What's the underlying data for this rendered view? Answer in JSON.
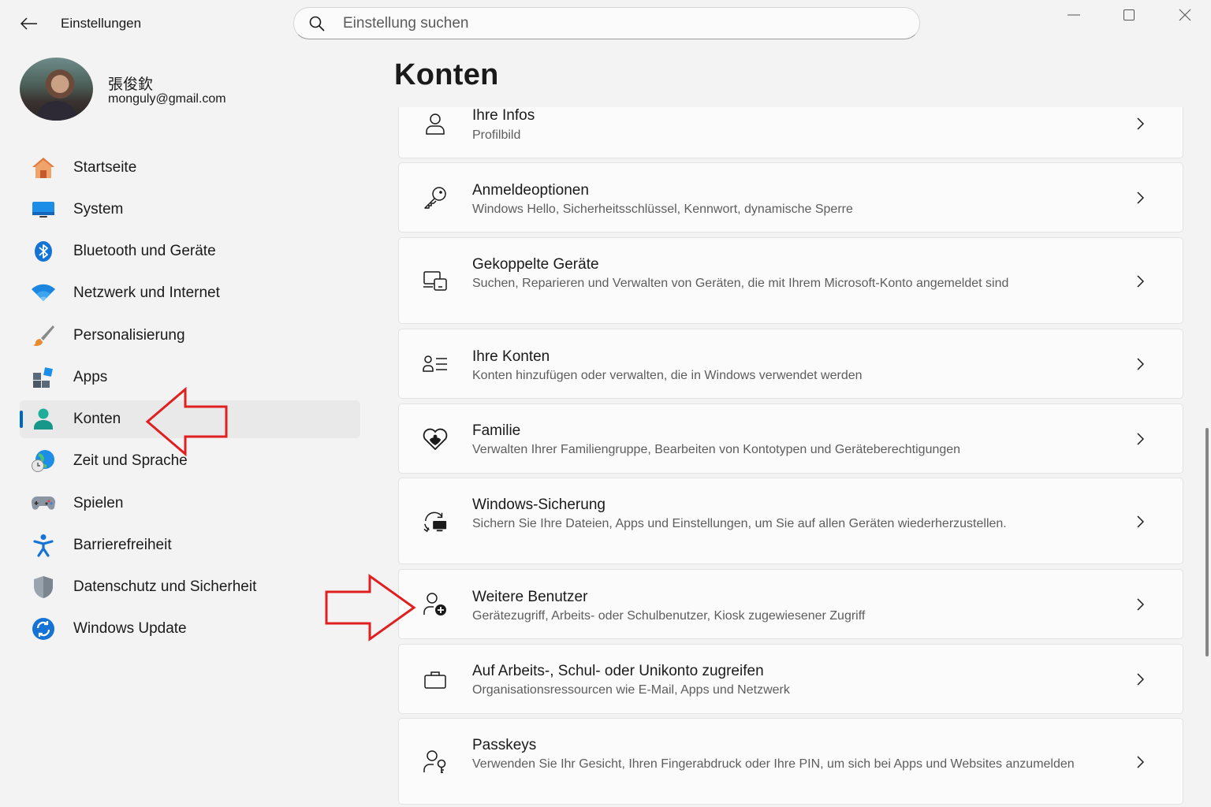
{
  "app": {
    "title": "Einstellungen"
  },
  "search": {
    "placeholder": "Einstellung suchen"
  },
  "user": {
    "name": "張俊欽",
    "email": "monguly@gmail.com"
  },
  "page_title": "Konten",
  "nav": [
    {
      "label": "Startseite",
      "icon": "home-icon"
    },
    {
      "label": "System",
      "icon": "monitor-icon"
    },
    {
      "label": "Bluetooth und Geräte",
      "icon": "bluetooth-icon"
    },
    {
      "label": "Netzwerk und Internet",
      "icon": "wifi-icon"
    },
    {
      "label": "Personalisierung",
      "icon": "brush-icon"
    },
    {
      "label": "Apps",
      "icon": "apps-icon"
    },
    {
      "label": "Konten",
      "icon": "account-icon",
      "active": true
    },
    {
      "label": "Zeit und Sprache",
      "icon": "globe-clock-icon"
    },
    {
      "label": "Spielen",
      "icon": "gamepad-icon"
    },
    {
      "label": "Barrierefreiheit",
      "icon": "accessibility-icon"
    },
    {
      "label": "Datenschutz und Sicherheit",
      "icon": "shield-icon"
    },
    {
      "label": "Windows Update",
      "icon": "update-icon"
    }
  ],
  "cards": [
    {
      "title": "Ihre Infos",
      "desc": "Profilbild",
      "icon": "person-icon"
    },
    {
      "title": "Anmeldeoptionen",
      "desc": "Windows Hello, Sicherheitsschlüssel, Kennwort, dynamische Sperre",
      "icon": "key-icon"
    },
    {
      "title": "Gekoppelte Geräte",
      "desc": "Suchen, Reparieren und Verwalten von Geräten, die mit Ihrem Microsoft-Konto angemeldet sind",
      "icon": "linked-devices-icon"
    },
    {
      "title": "Ihre Konten",
      "desc": "Konten hinzufügen oder verwalten, die in Windows verwendet werden",
      "icon": "accounts-list-icon"
    },
    {
      "title": "Familie",
      "desc": "Verwalten Ihrer Familiengruppe, Bearbeiten von Kontotypen und Geräteberechtigungen",
      "icon": "family-heart-icon"
    },
    {
      "title": "Windows-Sicherung",
      "desc": "Sichern Sie Ihre Dateien, Apps und Einstellungen, um Sie auf allen Geräten wiederherzustellen.",
      "icon": "backup-sync-icon"
    },
    {
      "title": "Weitere Benutzer",
      "desc": "Gerätezugriff, Arbeits- oder Schulbenutzer, Kiosk zugewiesener Zugriff",
      "icon": "person-add-icon"
    },
    {
      "title": "Auf Arbeits-, Schul- oder Unikonto zugreifen",
      "desc": "Organisationsressourcen wie E-Mail, Apps und Netzwerk",
      "icon": "briefcase-icon"
    },
    {
      "title": "Passkeys",
      "desc": "Verwenden Sie Ihr Gesicht, Ihren Fingerabdruck oder Ihre PIN, um sich bei Apps und Websites anzumelden",
      "icon": "passkey-icon"
    }
  ],
  "colors": {
    "accent": "#0067c0",
    "annotation": "#e02020"
  }
}
